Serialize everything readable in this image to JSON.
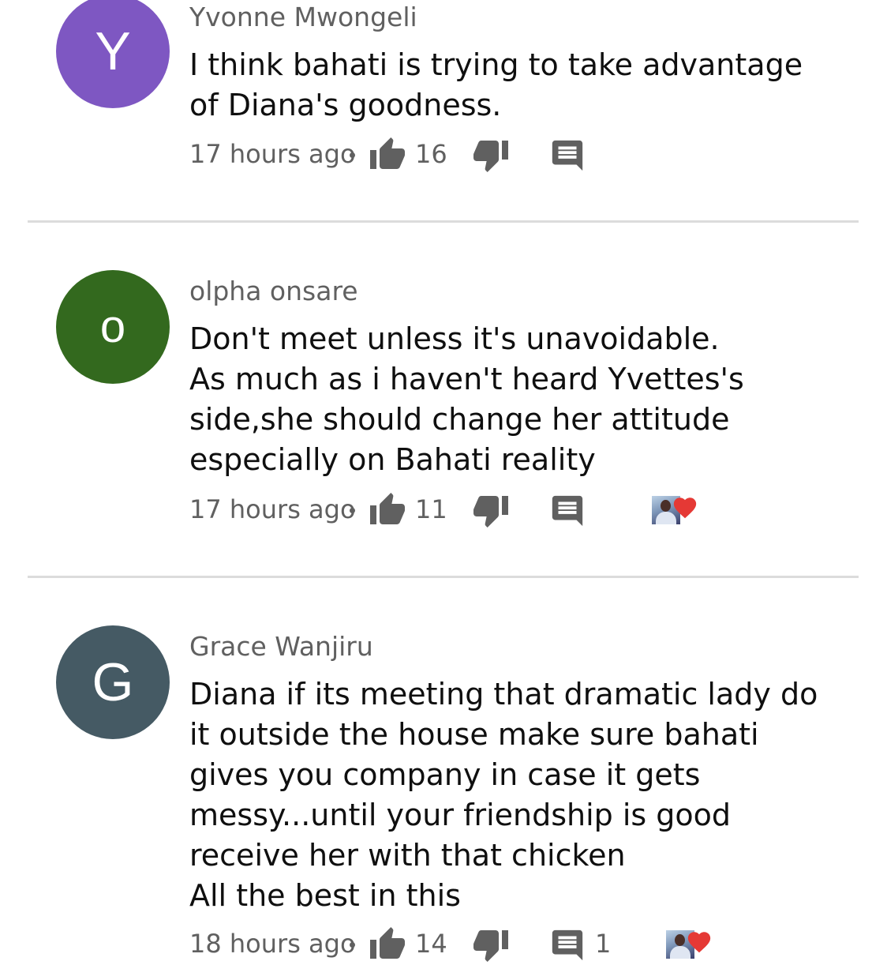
{
  "comments": [
    {
      "avatar_letter": "Y",
      "avatar_color": "#7e57c2",
      "author": "Yvonne Mwongeli",
      "text_lines": [
        "I think bahati is trying to take advantage",
        "of Diana's goodness."
      ],
      "time": "17 hours ago",
      "likes": "16",
      "replies": "",
      "creator_heart": false,
      "icons": {
        "like": "thumbs-up-icon",
        "dislike": "thumbs-down-icon",
        "reply": "reply-comment-icon"
      }
    },
    {
      "avatar_letter": "o",
      "avatar_color": "#33691e",
      "author": "olpha onsare",
      "text_lines": [
        "Don't meet unless it's unavoidable.",
        "As much as i haven't heard Yvettes's",
        "side,she should change her attitude",
        "especially on Bahati reality"
      ],
      "time": "17 hours ago",
      "likes": "11",
      "replies": "",
      "creator_heart": true,
      "icons": {
        "like": "thumbs-up-icon",
        "dislike": "thumbs-down-icon",
        "reply": "reply-comment-icon",
        "heart": "creator-heart-icon"
      }
    },
    {
      "avatar_letter": "G",
      "avatar_color": "#455a64",
      "author": "Grace Wanjiru",
      "text_lines": [
        "Diana if its meeting that dramatic lady do",
        "it outside the house make sure bahati",
        "gives you company in case it gets",
        "messy...until your friendship is good",
        "receive her with that chicken",
        "All the best in this"
      ],
      "time": "18 hours ago",
      "likes": "14",
      "replies": "1",
      "creator_heart": true,
      "icons": {
        "like": "thumbs-up-icon",
        "dislike": "thumbs-down-icon",
        "reply": "reply-comment-icon",
        "heart": "creator-heart-icon"
      }
    }
  ],
  "colors": {
    "meta_text": "#606060",
    "body_text": "#0f0f0f",
    "icon": "#606060",
    "heart": "#e53935",
    "divider": "#dcdcdc"
  }
}
